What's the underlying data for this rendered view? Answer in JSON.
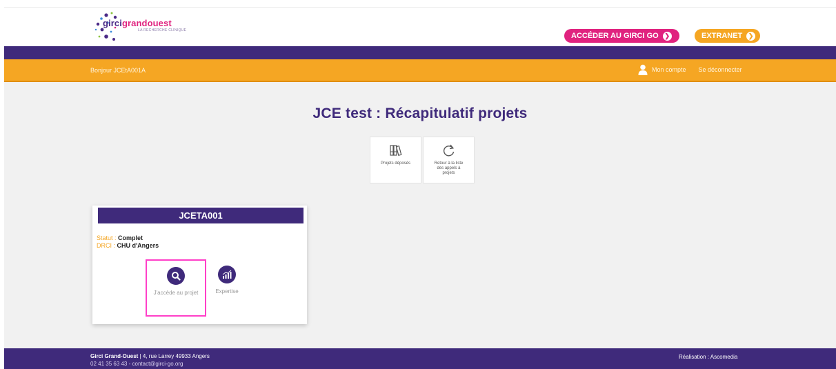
{
  "header": {
    "logo": {
      "brand_part1": "girci",
      "brand_part2": "grandouest",
      "tagline": "LA RECHERCHE CLINIQUE"
    },
    "girci_go_button": "ACCÉDER AU GIRCI GO",
    "extranet_button": "EXTRANET"
  },
  "topbar": {
    "greeting": "Bonjour JCEtA001A",
    "account_link": "Mon compte",
    "logout_link": "Se déconnecter"
  },
  "page": {
    "title": "JCE test : Récapitulatif projets",
    "tiles": [
      {
        "label": "Projets déposés",
        "icon": "books-icon"
      },
      {
        "label": "Retour à la liste des appels à projets",
        "icon": "refresh-icon"
      }
    ]
  },
  "project_card": {
    "code": "JCETA001",
    "status_label": "Statut :",
    "status_value": "Complet",
    "drci_label": "DRCI :",
    "drci_value": "CHU d'Angers",
    "actions": [
      {
        "label": "J'accède au projet",
        "icon": "search-icon"
      },
      {
        "label": "Expertise",
        "icon": "chart-icon"
      }
    ]
  },
  "footer": {
    "org_name": "Girci Grand-Ouest",
    "address": " | 4, rue Larrey 49933 Angers",
    "contact": "02 41 35 63 43 - contact@girci-go.org",
    "credit": "Réalisation : Ascomedia"
  },
  "colors": {
    "purple": "#3f2a7b",
    "orange": "#f5a623",
    "pink": "#e0237f",
    "highlight": "#ff3fc8"
  }
}
